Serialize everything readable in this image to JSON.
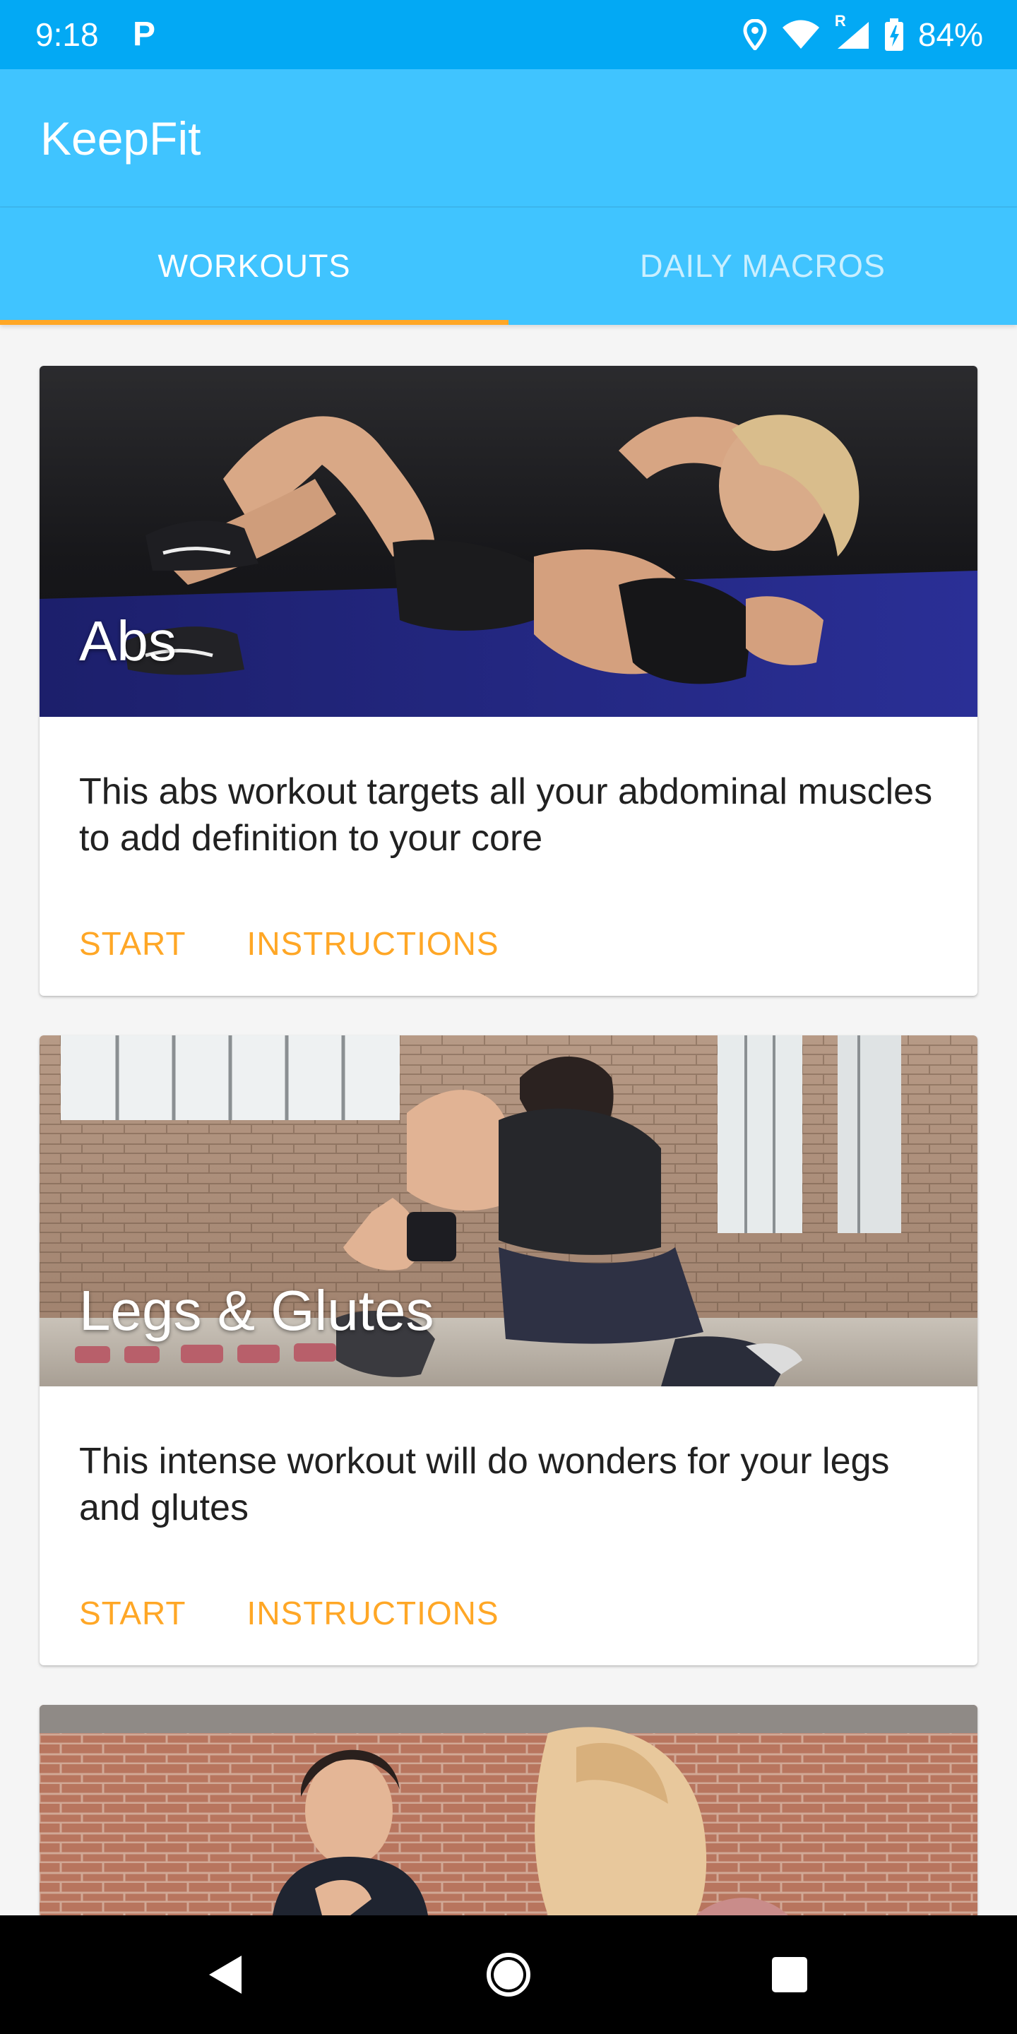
{
  "status_bar": {
    "time": "9:18",
    "notification_app": "P",
    "signal_roaming": "R",
    "battery_percent": "84%",
    "color": "#03a9f4"
  },
  "app_bar": {
    "title": "KeepFit",
    "color": "#40c4ff"
  },
  "tabs": [
    {
      "label": "WORKOUTS",
      "selected": true
    },
    {
      "label": "DAILY MACROS",
      "selected": false
    }
  ],
  "accent_color": "#ffa726",
  "workouts": [
    {
      "title": "Abs",
      "description": "This abs workout targets all your abdominal muscles to add definition to your core",
      "start_label": "START",
      "instructions_label": "INSTRUCTIONS",
      "image": "woman-doing-crunches-on-mat"
    },
    {
      "title": "Legs & Glutes",
      "description": "This intense workout will do wonders for your legs and glutes",
      "start_label": "START",
      "instructions_label": "INSTRUCTIONS",
      "image": "woman-stretching-in-brick-gym"
    },
    {
      "title": "",
      "image": "two-women-in-brick-gym"
    }
  ],
  "nav": {
    "back": "back-icon",
    "home": "home-icon",
    "recents": "recents-icon"
  }
}
